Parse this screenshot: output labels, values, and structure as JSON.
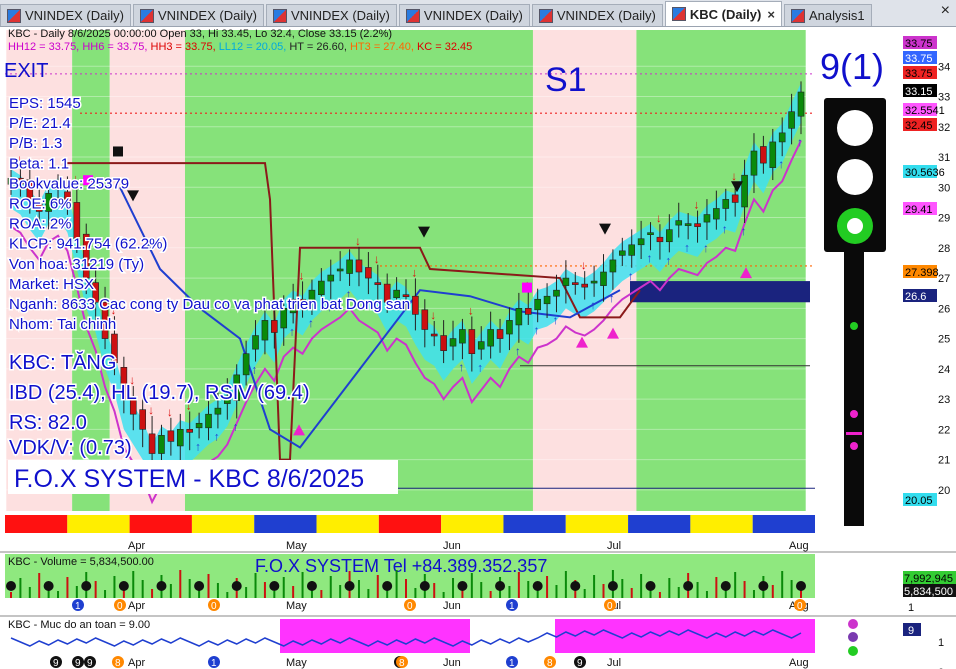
{
  "tabs": [
    {
      "label": "VNINDEX (Daily)",
      "active": false
    },
    {
      "label": "VNINDEX (Daily)",
      "active": false
    },
    {
      "label": "VNINDEX (Daily)",
      "active": false
    },
    {
      "label": "VNINDEX (Daily)",
      "active": false
    },
    {
      "label": "VNINDEX (Daily)",
      "active": false
    },
    {
      "label": "KBC (Daily)",
      "active": true
    },
    {
      "label": "Analysis1",
      "active": false
    }
  ],
  "tab_close": "×",
  "window_close": "×",
  "header": {
    "line1": "KBC - Daily 8/6/2025 00:00:00 Open 33, Hi 33.45, Lo 32.4, Close 33.15 (2.2%)",
    "line2_parts": [
      {
        "text": "HH12 = 33.75, ",
        "color": "#cc00cc"
      },
      {
        "text": "HH6 = 33.75, ",
        "color": "#cc00cc"
      },
      {
        "text": "HH3 = 33.75, ",
        "color": "#dd0000"
      },
      {
        "text": "LL12 = 20.05, ",
        "color": "#00aadd"
      },
      {
        "text": "HT  = 26.60, ",
        "color": "#222222"
      },
      {
        "text": "HT3  = 27.40, ",
        "color": "#ff6600"
      },
      {
        "text": "KC = 32.45",
        "color": "#dd0000"
      }
    ]
  },
  "overlay": {
    "exit_label": "EXIT",
    "s1_label": "S1",
    "signal_count": "9(1)",
    "fundamentals": [
      "EPS: 1545",
      "P/E: 21.4",
      "P/B: 1.3",
      "Beta: 1.1",
      "Bookvalue: 25379",
      "ROE: 6%",
      "ROA: 2%",
      "KLCP: 941.754 (62.2%)",
      "Von hoa: 31219 (Ty)",
      "Market: HSX",
      "Nganh: 8633 Cac cong ty Dau co va phat trien bat Dong san",
      "Nhom: Tai chinh"
    ],
    "trend": "KBC: TĂNG",
    "ibd": "IBD (25.4), HL (19.7), RSIV (69.4)",
    "rs": "RS: 82.0",
    "vdk": "VDK/V:  (0.73)",
    "system_title": "F.O.X SYSTEM - KBC 8/6/2025"
  },
  "price_axis": {
    "ticks": [
      "34",
      "33",
      "32",
      "31",
      "30",
      "29",
      "28",
      "27",
      "26",
      "25",
      "24",
      "23",
      "22",
      "21",
      "20"
    ],
    "tags": [
      {
        "text": "33.75",
        "bg": "#cc33cc",
        "fg": "#000000",
        "value": 33.75
      },
      {
        "text": "33.75",
        "bg": "#3366ff",
        "fg": "#ffffff",
        "value": 33.75
      },
      {
        "text": "33.75",
        "bg": "#ee2222",
        "fg": "#000000",
        "value": 33.75
      },
      {
        "text": "33.15",
        "bg": "#000000",
        "fg": "#ffffff",
        "value": 33.15
      },
      {
        "text": "32.5541",
        "bg": "#ff55ff",
        "fg": "#000000",
        "value": 32.5541
      },
      {
        "text": "32.45",
        "bg": "#ee2222",
        "fg": "#000000",
        "value": 32.45
      },
      {
        "text": "30.5636",
        "bg": "#33ddee",
        "fg": "#000000",
        "value": 30.5636
      },
      {
        "text": "29.41",
        "bg": "#ff55ff",
        "fg": "#000000",
        "value": 29.41
      },
      {
        "text": "27.398",
        "bg": "#ff8800",
        "fg": "#000000",
        "value": 27.398
      },
      {
        "text": "26.6",
        "bg": "#1a237e",
        "fg": "#ffffff",
        "value": 26.6
      },
      {
        "text": "20.05",
        "bg": "#33ddee",
        "fg": "#000000",
        "value": 20.05
      }
    ]
  },
  "months": [
    "Apr",
    "May",
    "Jun",
    "Jul",
    "Aug"
  ],
  "volume": {
    "label": "KBC - Volume = 5,834,500.00",
    "title": "F.O.X SYSTEM Tel +84.389.352.357",
    "axis_tags": [
      {
        "text": "7,992,945",
        "bg": "#33cc33",
        "fg": "#000000"
      },
      {
        "text": "5,834,500",
        "bg": "#111111",
        "fg": "#ffffff"
      }
    ],
    "axis_tick": "1",
    "markers": [
      "1",
      "0",
      "0",
      "0",
      "1",
      "0",
      "0"
    ]
  },
  "safety": {
    "label": "KBC - Muc do an toan = 9.00",
    "axis_tag": {
      "text": "9",
      "bg": "#1a237e",
      "fg": "#ffffff"
    },
    "axis_ticks": [
      "1",
      "0"
    ],
    "markers": [
      "9",
      "9",
      "9",
      "8",
      "1",
      "9",
      "8",
      "1",
      "8",
      "9"
    ]
  },
  "chart_data": {
    "type": "candlestick",
    "title": "KBC - Daily 8/6/2025",
    "ylim": [
      19.3,
      35.2
    ],
    "x_labels": [
      "Apr",
      "May",
      "Jun",
      "Jul",
      "Aug"
    ],
    "last_bar": {
      "date": "8/6/2025",
      "open": 33,
      "high": 33.45,
      "low": 32.4,
      "close": 33.15,
      "change_pct": 2.2
    },
    "levels": {
      "HH12": 33.75,
      "HH6": 33.75,
      "HH3": 33.75,
      "LL12": 20.05,
      "HT": 26.6,
      "HT3": 27.4,
      "KC": 32.45
    },
    "close_series": [
      30.3,
      30.1,
      29.6,
      29.2,
      29.8,
      30.0,
      29.5,
      28.3,
      27.0,
      26.2,
      25.0,
      24.2,
      23.0,
      22.5,
      22.0,
      21.2,
      21.8,
      21.6,
      22.0,
      21.9,
      22.2,
      22.5,
      22.7,
      23.1,
      23.8,
      24.5,
      25.1,
      25.6,
      25.2,
      26.0,
      26.3,
      26.1,
      26.6,
      26.9,
      27.1,
      27.3,
      27.6,
      27.2,
      27.0,
      26.8,
      26.2,
      26.6,
      26.4,
      25.8,
      25.3,
      25.1,
      24.6,
      25.0,
      25.3,
      24.5,
      24.9,
      25.3,
      25.0,
      25.6,
      26.0,
      25.8,
      26.3,
      26.4,
      26.6,
      27.0,
      26.8,
      26.7,
      26.9,
      27.2,
      27.6,
      27.9,
      28.1,
      28.3,
      28.5,
      28.2,
      28.6,
      28.9,
      28.8,
      28.7,
      29.1,
      29.3,
      29.6,
      29.5,
      30.4,
      31.2,
      30.8,
      31.5,
      31.8,
      32.5,
      33.15
    ]
  }
}
